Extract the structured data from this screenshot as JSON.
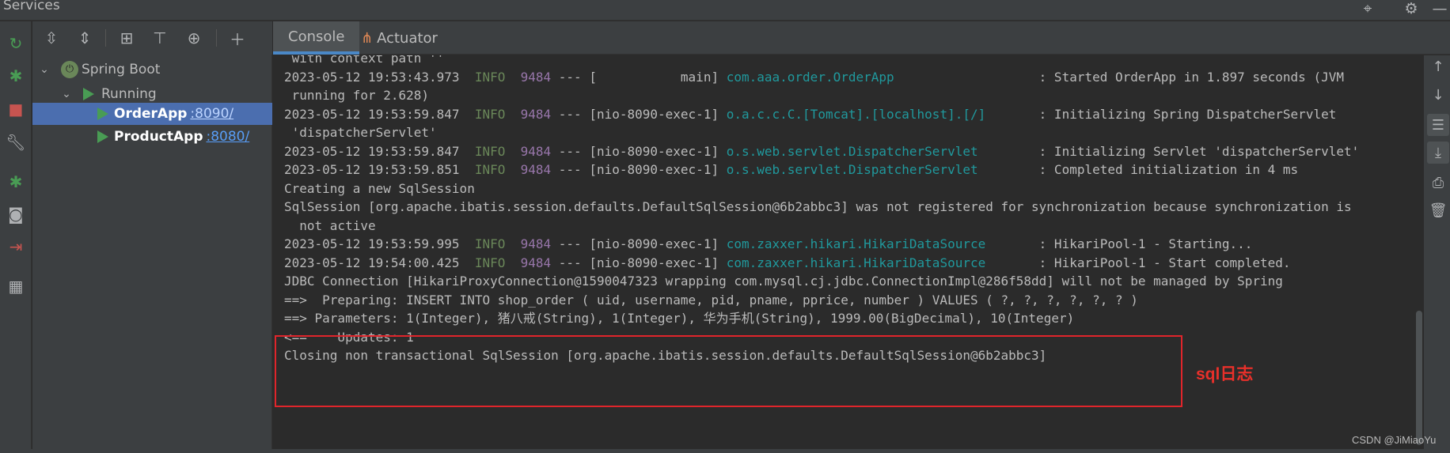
{
  "window": {
    "title": "Services",
    "title_icons": [
      "crosshair-icon",
      "gear-icon",
      "minimize-icon"
    ]
  },
  "left_toolbar": {
    "icons": [
      "rerun-icon",
      "debug-icon",
      "stop-icon",
      "wrench-icon",
      "debug-attach-icon",
      "camera-icon",
      "exit-icon",
      "layout-icon"
    ]
  },
  "tree_toolbar": {
    "icons": [
      "expand-all-icon",
      "collapse-all-icon",
      "group-icon",
      "filter-icon",
      "new-service-icon",
      "add-icon"
    ]
  },
  "tree": {
    "root": {
      "label": "Spring Boot",
      "expanded": true
    },
    "group": {
      "label": "Running",
      "expanded": true
    },
    "apps": [
      {
        "name": "OrderApp",
        "port": ":8090/",
        "selected": true
      },
      {
        "name": "ProductApp",
        "port": ":8080/",
        "selected": false
      }
    ]
  },
  "tabs": [
    {
      "label": "Console",
      "active": true
    },
    {
      "label": "Actuator",
      "active": false
    }
  ],
  "console": {
    "lines": [
      {
        "plain": " with context path ''"
      },
      {
        "ts": "2023-05-12 19:53:43.973",
        "level": "INFO",
        "pid": "9484",
        "thread": " --- [           main] ",
        "logger": "com.aaa.order.OrderApp                  ",
        "msg": " : Started OrderApp in 1.897 seconds (JVM"
      },
      {
        "plain": " running for 2.628)"
      },
      {
        "ts": "2023-05-12 19:53:59.847",
        "level": "INFO",
        "pid": "9484",
        "thread": " --- [nio-8090-exec-1] ",
        "logger": "o.a.c.c.C.[Tomcat].[localhost].[/]      ",
        "msg": " : Initializing Spring DispatcherServlet"
      },
      {
        "plain": " 'dispatcherServlet'"
      },
      {
        "ts": "2023-05-12 19:53:59.847",
        "level": "INFO",
        "pid": "9484",
        "thread": " --- [nio-8090-exec-1] ",
        "logger": "o.s.web.servlet.DispatcherServlet       ",
        "msg": " : Initializing Servlet 'dispatcherServlet'"
      },
      {
        "ts": "2023-05-12 19:53:59.851",
        "level": "INFO",
        "pid": "9484",
        "thread": " --- [nio-8090-exec-1] ",
        "logger": "o.s.web.servlet.DispatcherServlet       ",
        "msg": " : Completed initialization in 4 ms"
      },
      {
        "plain": "Creating a new SqlSession"
      },
      {
        "plain": "SqlSession [org.apache.ibatis.session.defaults.DefaultSqlSession@6b2abbc3] was not registered for synchronization because synchronization is"
      },
      {
        "plain": "  not active"
      },
      {
        "ts": "2023-05-12 19:53:59.995",
        "level": "INFO",
        "pid": "9484",
        "thread": " --- [nio-8090-exec-1] ",
        "logger": "com.zaxxer.hikari.HikariDataSource      ",
        "msg": " : HikariPool-1 - Starting..."
      },
      {
        "ts": "2023-05-12 19:54:00.425",
        "level": "INFO",
        "pid": "9484",
        "thread": " --- [nio-8090-exec-1] ",
        "logger": "com.zaxxer.hikari.HikariDataSource      ",
        "msg": " : HikariPool-1 - Start completed."
      },
      {
        "plain": "JDBC Connection [HikariProxyConnection@1590047323 wrapping com.mysql.cj.jdbc.ConnectionImpl@286f58dd] will not be managed by Spring"
      },
      {
        "plain": "==>  Preparing: INSERT INTO shop_order ( uid, username, pid, pname, pprice, number ) VALUES ( ?, ?, ?, ?, ?, ? )"
      },
      {
        "plain": "==> Parameters: 1(Integer), 猪八戒(String), 1(Integer), 华为手机(String), 1999.00(BigDecimal), 10(Integer)"
      },
      {
        "plain": "<==    Updates: 1"
      },
      {
        "plain": "Closing non transactional SqlSession [org.apache.ibatis.session.defaults.DefaultSqlSession@6b2abbc3]"
      }
    ],
    "annotation": "sql日志"
  },
  "right_toolbar": {
    "icons": [
      "scroll-up-icon",
      "scroll-down-icon",
      "soft-wrap-icon",
      "scroll-to-end-icon",
      "print-icon",
      "trash-icon"
    ]
  },
  "watermark": "CSDN @JiMiaoYu",
  "colors": {
    "background": "#2b2b2b",
    "panel": "#3c3f41",
    "selection": "#4b6eaf",
    "info": "#6a8759",
    "pid": "#9876aa",
    "logger": "#20999d",
    "highlight_border": "#e0252b",
    "annotation": "#e8302a"
  }
}
